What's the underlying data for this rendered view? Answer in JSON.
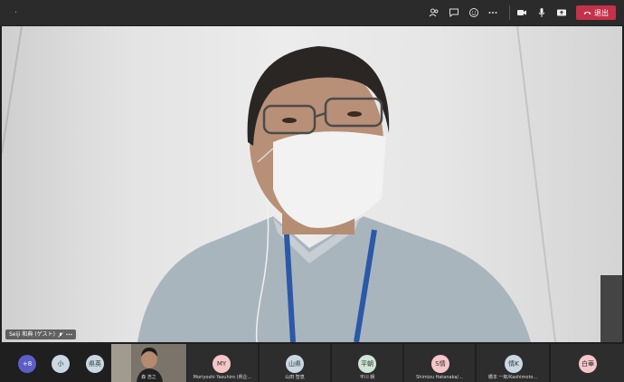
{
  "topbar": {
    "title": ".",
    "icons": [
      "participants-icon",
      "chat-icon",
      "reactions-icon",
      "more-icon",
      "camera-icon",
      "mic-icon",
      "share-icon"
    ],
    "leave_label": "退出",
    "leave_color": "#c4314b"
  },
  "main_video": {
    "participant_label": "Seiji 和典 (ゲスト)",
    "status_icons": [
      "mic-off-icon",
      "more-icon"
    ]
  },
  "strip": {
    "more_count": "+8",
    "participants": [
      {
        "initials": "小",
        "name": "",
        "color": "#c9d8e2"
      },
      {
        "initials": "県英",
        "name": "",
        "color": "#c9d8e2"
      },
      {
        "initials": "MY",
        "name": "Moriyoshi Yasuhiro (県企...",
        "color": "#f4c6c8"
      },
      {
        "initials": "山県",
        "name": "山田 智恵",
        "color": "#c9d8e2"
      },
      {
        "initials": "平朝",
        "name": "平川 朝",
        "color": "#cfe5d6"
      },
      {
        "initials": "S情",
        "name": "Shimizu Hatanaka/...",
        "color": "#f4c6c8"
      },
      {
        "initials": "情K",
        "name": "橋本 一郎/Kashimoto...",
        "color": "#c9d8e2"
      },
      {
        "initials": "白華",
        "name": "",
        "color": "#f4c6c8"
      }
    ],
    "self_name": "森 浩之"
  },
  "colors": {
    "background": "#1f1f1f",
    "topbar": "#2b2b2b",
    "tile": "#2d2d2d",
    "accent": "#5b5fc7"
  }
}
